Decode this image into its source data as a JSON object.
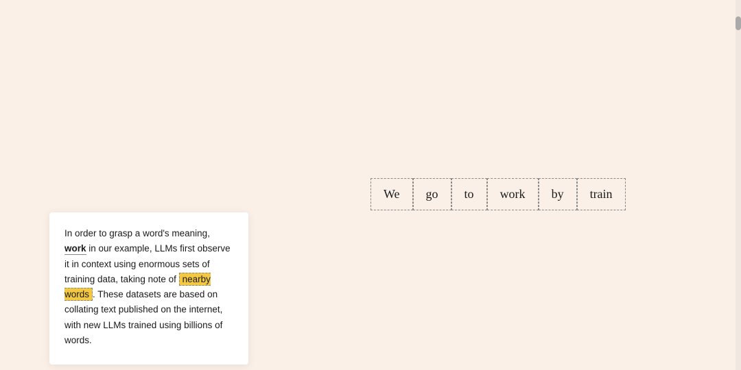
{
  "background_color": "#faf0e8",
  "sentence": {
    "words": [
      "We",
      "go",
      "to",
      "work",
      "by",
      "train"
    ]
  },
  "info_card": {
    "text_parts": [
      "In order to grasp a word's meaning, ",
      "work",
      " in our example, LLMs first observe it in context using enormous sets of training data, taking note of ",
      "nearby words",
      ". These datasets are based on collating text published on the internet, with new LLMs trained using billions of words."
    ]
  }
}
